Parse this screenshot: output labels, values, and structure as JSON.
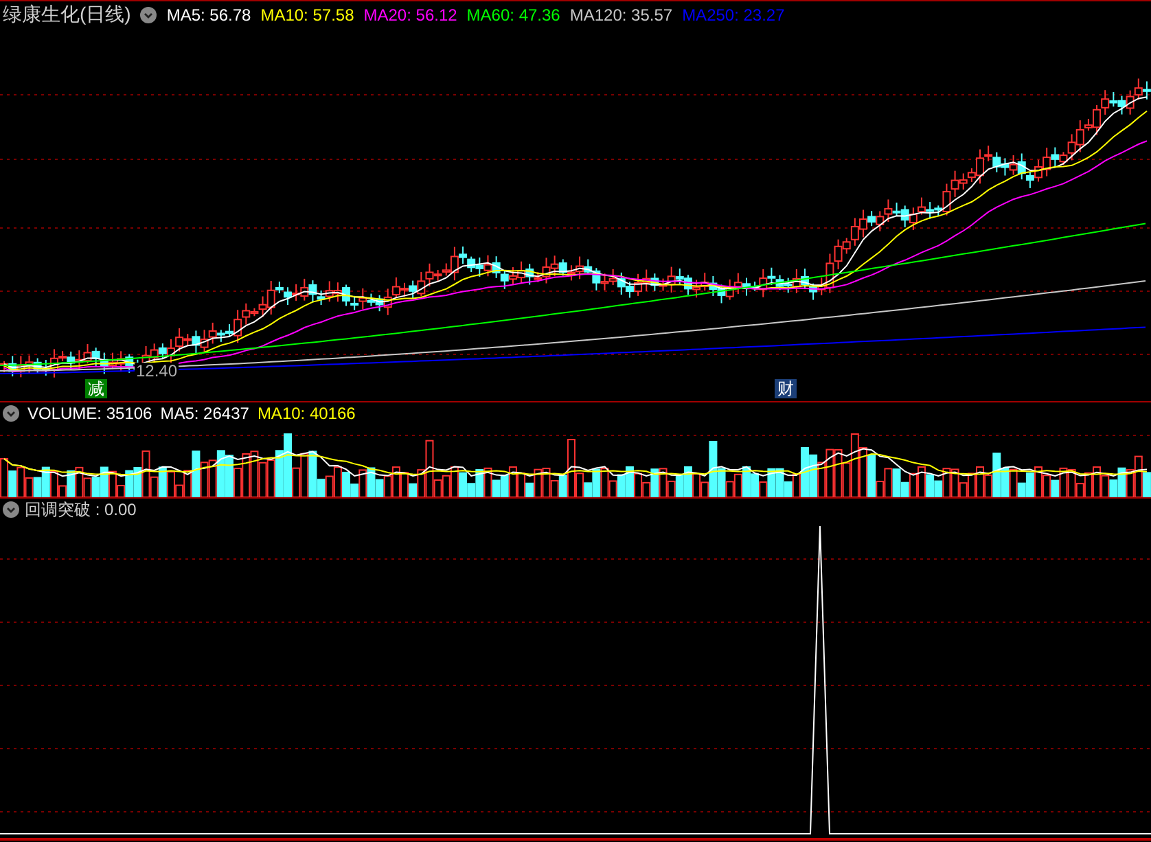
{
  "title": "绿康生化(日线)",
  "price_indicators": [
    {
      "label": "MA5: 56.78",
      "color": "#ffffff"
    },
    {
      "label": "MA10: 57.58",
      "color": "#ffff00"
    },
    {
      "label": "MA20: 56.12",
      "color": "#ff00ff"
    },
    {
      "label": "MA60: 47.36",
      "color": "#00ff00"
    },
    {
      "label": "MA120: 35.57",
      "color": "#c8c8c8"
    },
    {
      "label": "MA250: 23.27",
      "color": "#0000ff"
    }
  ],
  "price_label": "12.40",
  "event_markers": [
    {
      "label": "减",
      "color": "#008000"
    },
    {
      "label": "财",
      "color": "#1c3f78"
    }
  ],
  "volume_indicators": [
    {
      "label": "VOLUME: 35106",
      "color": "#ffffff"
    },
    {
      "label": "MA5: 26437",
      "color": "#ffffff"
    },
    {
      "label": "MA10: 40166",
      "color": "#ffff00"
    }
  ],
  "signal_indicator": {
    "label": "回调突破 : 0.00"
  }
}
